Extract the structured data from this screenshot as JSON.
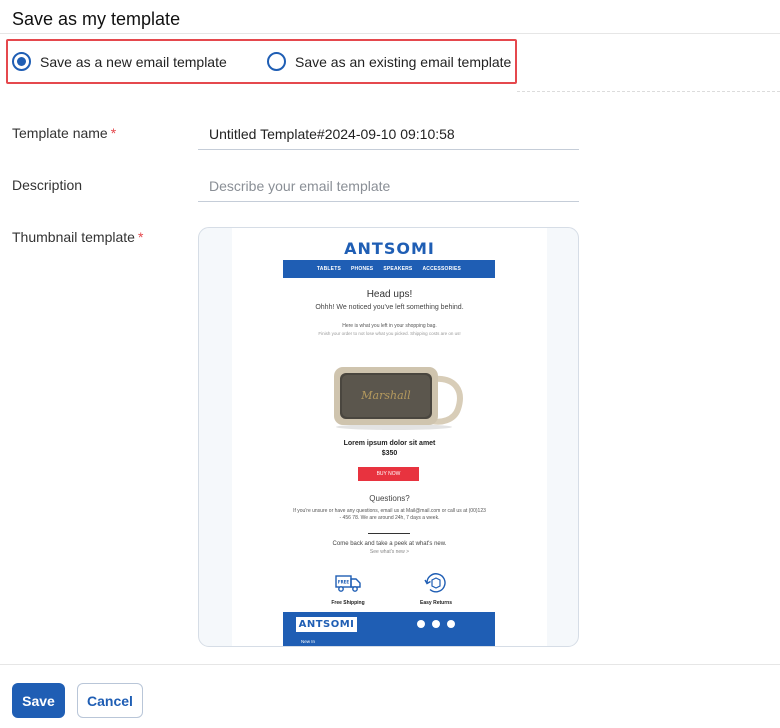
{
  "dialog": {
    "title": "Save as my template"
  },
  "save_mode": {
    "options": [
      {
        "label": "Save as a new email template",
        "selected": true
      },
      {
        "label": "Save as an existing email template",
        "selected": false
      }
    ]
  },
  "form": {
    "template_name": {
      "label": "Template name",
      "required_mark": "*",
      "value": "Untitled Template#2024-09-10 09:10:58"
    },
    "description": {
      "label": "Description",
      "placeholder": "Describe your email template",
      "value": ""
    },
    "thumbnail": {
      "label": "Thumbnail template",
      "required_mark": "*"
    }
  },
  "thumbnail_preview": {
    "brand": "ANTSOMI",
    "nav_items": [
      "TABLETS",
      "PHONES",
      "SPEAKERS",
      "ACCESSORIES"
    ],
    "heading": "Head ups!",
    "subheading": "Ohhh! We noticed you've left something behind.",
    "line1": "Here is what you left in your shopping bag.",
    "line2": "Finish your order to not lose what you picked. Shipping costs are on us!",
    "product_name": "Lorem ipsum dolor sit amet",
    "product_price": "$350",
    "buy_label": "BUY NOW",
    "questions_heading": "Questions?",
    "questions_text": "If you're unsure or have any questions, email us at Mail@mail.com or call us at (00)123 - 456 78. We are around 24h, 7 days a week.",
    "come_back": "Come back and take a peek at what's new.",
    "see_new": "See what's new >",
    "features": [
      "Free Shipping",
      "Easy Returns"
    ],
    "footer_text": "New In"
  },
  "colors": {
    "primary": "#1f5eb4",
    "danger": "#e5484d",
    "buy": "#e8333f"
  },
  "actions": {
    "save_label": "Save",
    "cancel_label": "Cancel"
  }
}
